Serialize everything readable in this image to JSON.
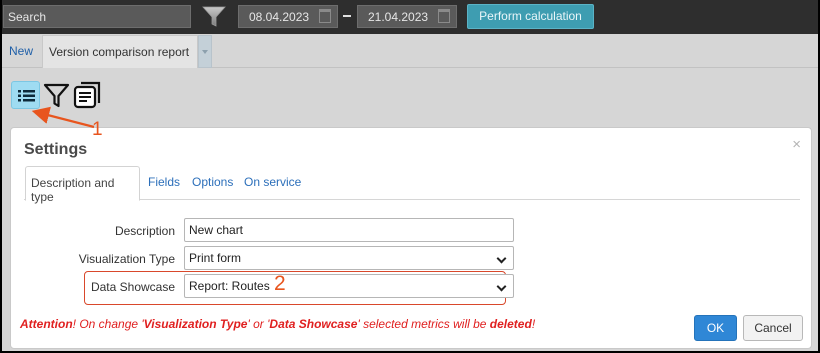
{
  "toolbar": {
    "search_placeholder": "Search",
    "date_from": "08.04.2023",
    "date_to": "21.04.2023",
    "perform_label": "Perform calculation",
    "filter_icon": "funnel-icon",
    "calendar_icon": "calendar-icon"
  },
  "tabs": {
    "new_label": "New",
    "active_label": "Version comparison report"
  },
  "icons": {
    "list": "list-icon",
    "filter": "filter-icon",
    "document": "document-icon"
  },
  "annotations": {
    "marker1": "1",
    "marker2": "2",
    "color": "#e8551e"
  },
  "dialog": {
    "title": "Settings",
    "close": "×",
    "tabs": [
      "Description and type",
      "Fields",
      "Options",
      "On service"
    ],
    "fields": {
      "description_label": "Description",
      "description_value": "New chart",
      "visualization_label": "Visualization Type",
      "visualization_value": "Print form",
      "showcase_label": "Data Showcase",
      "showcase_value": "Report: Routes"
    },
    "attention": {
      "prefix": "Attention",
      "text1": "! On change '",
      "term1": "Visualization Type",
      "text2": "' or '",
      "term2": "Data Showcase",
      "text3": "' selected metrics will be ",
      "term3": "deleted",
      "text4": "!"
    },
    "ok_label": "OK",
    "cancel_label": "Cancel"
  }
}
